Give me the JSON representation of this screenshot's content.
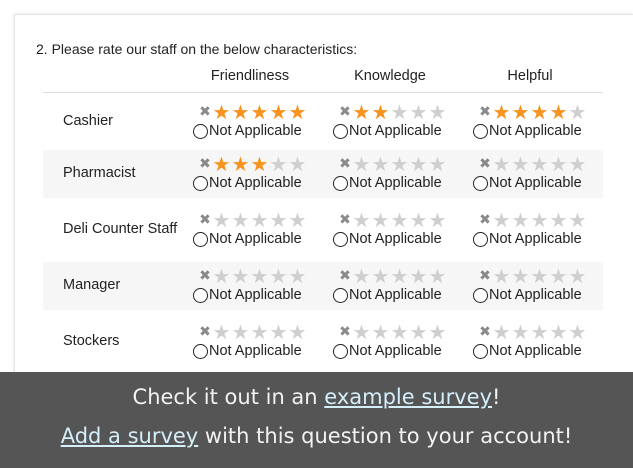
{
  "question": {
    "number": "2.",
    "title": "Please rate our staff on the below characteristics:"
  },
  "columns": [
    "Friendliness",
    "Knowledge",
    "Helpful"
  ],
  "na_label": "Not Applicable",
  "star_max": 5,
  "rows": [
    {
      "label": "Cashier",
      "ratings": [
        5,
        2,
        4
      ]
    },
    {
      "label": "Pharmacist",
      "ratings": [
        3,
        0,
        0
      ]
    },
    {
      "label": "Deli Counter Staff",
      "ratings": [
        0,
        0,
        0
      ]
    },
    {
      "label": "Manager",
      "ratings": [
        0,
        0,
        0
      ]
    },
    {
      "label": "Stockers",
      "ratings": [
        0,
        0,
        0
      ]
    }
  ],
  "icons": {
    "clear": "clear-x-icon",
    "star": "star-icon",
    "radio": "radio-unchecked"
  },
  "colors": {
    "star_on": "#f7931e",
    "star_off": "#cfcfcf",
    "banner_bg": "#555555",
    "link": "#d4eefa"
  },
  "banner": {
    "line1_prefix": "Check it out in an ",
    "line1_link": "example survey",
    "line1_suffix": "!",
    "line2_link": "Add a survey",
    "line2_suffix": " with this question to your account!"
  }
}
